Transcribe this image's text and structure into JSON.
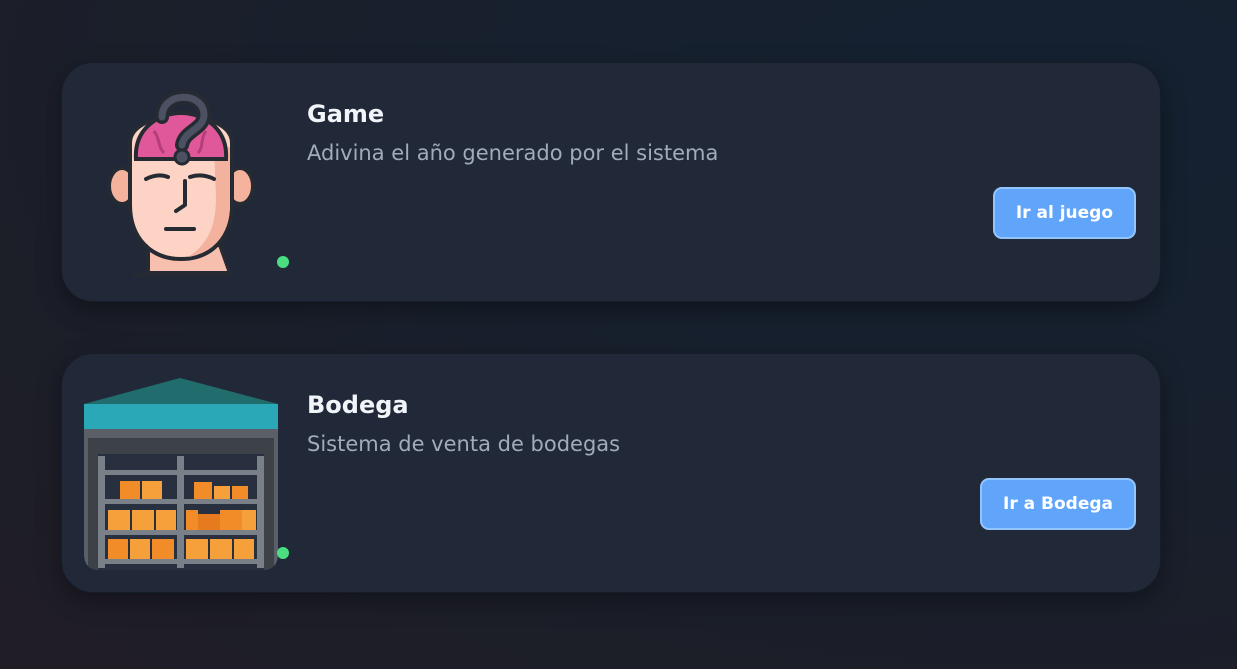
{
  "cards": [
    {
      "title": "Game",
      "description": "Adivina el año generado por el sistema",
      "button_label": "Ir al juego",
      "icon": "thinking-head-icon",
      "status": "online"
    },
    {
      "title": "Bodega",
      "description": "Sistema de venta de bodegas",
      "button_label": "Ir a Bodega",
      "icon": "warehouse-icon",
      "status": "online"
    }
  ],
  "colors": {
    "card_background": "#212938",
    "button": "#60a5fa",
    "status_online": "#4ade80"
  }
}
